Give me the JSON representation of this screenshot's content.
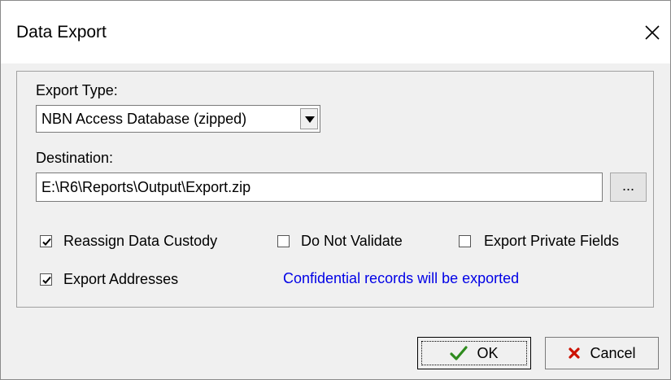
{
  "dialog": {
    "title": "Data Export"
  },
  "export_type": {
    "label": "Export Type:",
    "selected": "NBN Access Database (zipped)"
  },
  "destination": {
    "label": "Destination:",
    "value": "E:\\R6\\Reports\\Output\\Export.zip",
    "browse_label": "..."
  },
  "options": {
    "reassign_custody": {
      "label": "Reassign Data Custody",
      "checked": true
    },
    "do_not_validate": {
      "label": "Do Not Validate",
      "checked": false
    },
    "export_private": {
      "label": "Export Private Fields",
      "checked": false
    },
    "export_addresses": {
      "label": "Export Addresses",
      "checked": true
    }
  },
  "info_message": "Confidential records will be exported",
  "buttons": {
    "ok_label": "OK",
    "cancel_label": "Cancel"
  },
  "colors": {
    "info_text": "#0000e6",
    "ok_check": "#2e8b1e",
    "cancel_x": "#cc1100"
  },
  "icons": {
    "close": "close-icon",
    "dropdown": "chevron-down-icon",
    "ok": "checkmark-icon",
    "cancel": "x-icon"
  }
}
